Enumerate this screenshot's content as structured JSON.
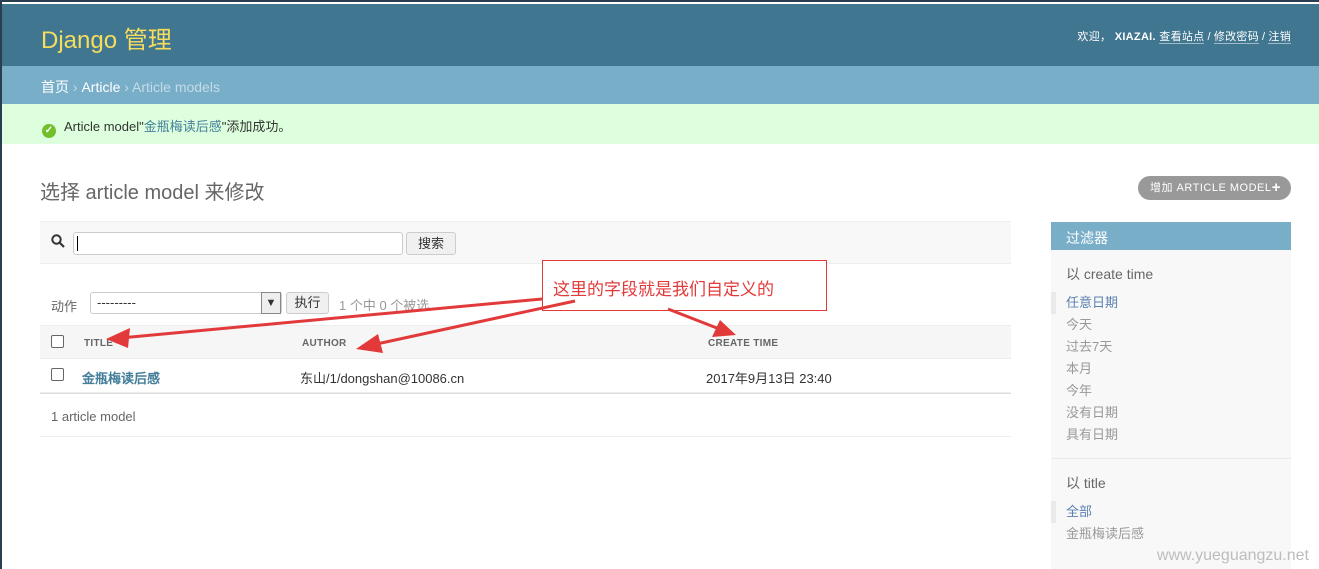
{
  "header": {
    "brand": "Django 管理",
    "welcome": "欢迎，",
    "username": "XIAZAI.",
    "links": [
      "查看站点",
      "修改密码",
      "注销"
    ]
  },
  "breadcrumbs": {
    "home": "首页",
    "app": "Article",
    "current": "Article models"
  },
  "message": {
    "prefix": "Article model\"",
    "object": "金瓶梅读后感",
    "suffix": "\"添加成功。"
  },
  "content": {
    "title": "选择 article model 来修改",
    "add_button": "增加 ARTICLE MODEL"
  },
  "search": {
    "value": "",
    "button": "搜索"
  },
  "actions": {
    "label": "动作",
    "selected_option": "---------",
    "run_button": "执行",
    "selection_count": "1 个中 0 个被选"
  },
  "table": {
    "columns": [
      "TITLE",
      "AUTHOR",
      "CREATE TIME"
    ],
    "rows": [
      {
        "title": "金瓶梅读后感",
        "author": "东山/1/dongshan@10086.cn",
        "create_time": "2017年9月13日 23:40"
      }
    ],
    "paginator": "1 article model"
  },
  "filter": {
    "title": "过滤器",
    "groups": [
      {
        "title": "以 create time",
        "items": [
          "任意日期",
          "今天",
          "过去7天",
          "本月",
          "今年",
          "没有日期",
          "具有日期"
        ]
      },
      {
        "title": "以 title",
        "items": [
          "全部",
          "金瓶梅读后感"
        ]
      }
    ]
  },
  "annotation": {
    "text": "这里的字段就是我们自定义的"
  },
  "watermark": "www.yueguangzu.net",
  "colors": {
    "header_bg": "#417690",
    "brand": "#f5dd5d",
    "breadcrumb_bg": "#79aec8",
    "success_bg": "#dddddd",
    "link": "#447e9b",
    "annotation": "#e23a3a"
  },
  "icons": {
    "success": "check-circle-icon",
    "search": "search-icon",
    "add": "plus-icon",
    "select": "chevron-down-icon"
  }
}
